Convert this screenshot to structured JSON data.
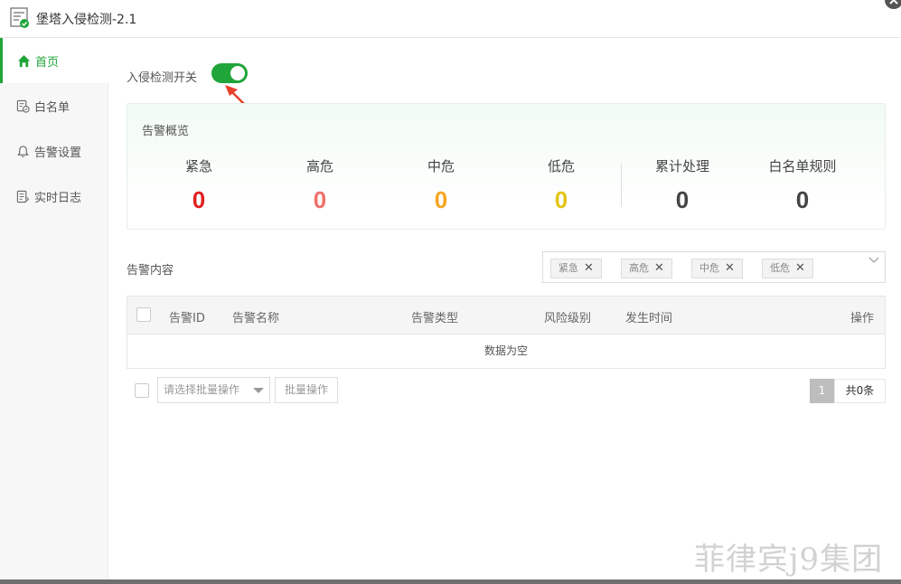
{
  "window": {
    "title": "堡塔入侵检测-2.1"
  },
  "sidebar": {
    "items": [
      {
        "label": "首页",
        "icon": "home-icon",
        "active": true
      },
      {
        "label": "白名单",
        "icon": "whitelist-icon",
        "active": false
      },
      {
        "label": "告警设置",
        "icon": "bell-icon",
        "active": false
      },
      {
        "label": "实时日志",
        "icon": "log-icon",
        "active": false
      }
    ]
  },
  "main": {
    "switch_label": "入侵检测开关",
    "switch_on": true,
    "overview": {
      "title": "告警概览",
      "stats": [
        {
          "label": "紧急",
          "value": "0",
          "color": "#e02020"
        },
        {
          "label": "高危",
          "value": "0",
          "color": "#f0706a"
        },
        {
          "label": "中危",
          "value": "0",
          "color": "#f7a521"
        },
        {
          "label": "低危",
          "value": "0",
          "color": "#e2c415"
        },
        {
          "label": "累计处理",
          "value": "0",
          "color": "#444444"
        },
        {
          "label": "白名单规则",
          "value": "0",
          "color": "#444444"
        }
      ]
    },
    "content_title": "告警内容",
    "filter_tags": [
      "紧急",
      "高危",
      "中危",
      "低危"
    ],
    "table": {
      "columns": [
        "告警ID",
        "告警名称",
        "告警类型",
        "风险级别",
        "发生时间",
        "操作"
      ],
      "empty_text": "数据为空"
    },
    "batch": {
      "select_placeholder": "请选择批量操作",
      "button_label": "批量操作"
    },
    "pagination": {
      "current_page": "1",
      "total": "共0条"
    }
  },
  "watermark": "菲律宾j9集团",
  "colors": {
    "accent": "#20a53a",
    "arrow": "#e8412b"
  }
}
